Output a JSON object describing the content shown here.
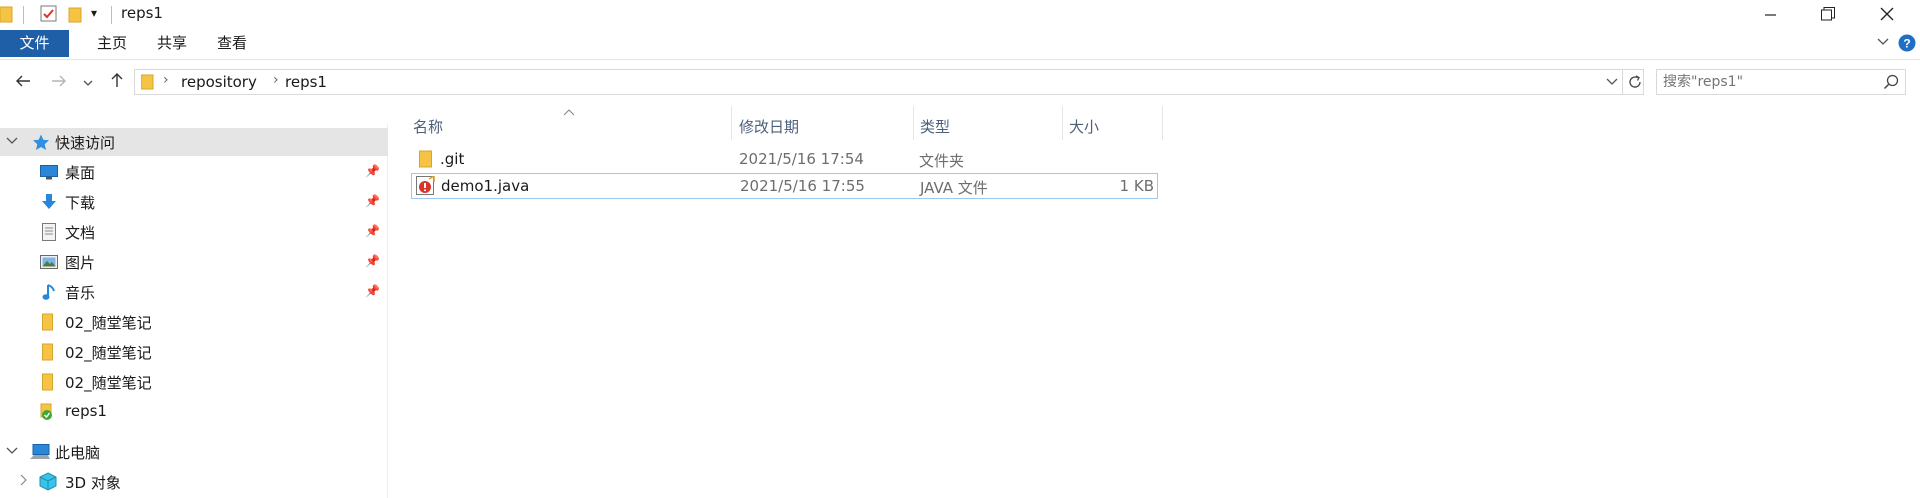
{
  "titlebar": {
    "title": "reps1",
    "quick_access_toolbar": [
      "folder-icon",
      "properties-icon",
      "new-folder-icon",
      "customize-dropdown-icon"
    ],
    "controls": [
      "minimize-icon",
      "maximize-icon",
      "close-icon"
    ]
  },
  "ribbon": {
    "tabs": [
      {
        "label": "文件",
        "active": true
      },
      {
        "label": "主页"
      },
      {
        "label": "共享"
      },
      {
        "label": "查看"
      }
    ],
    "expand_icon": "chevron-down-icon",
    "help_icon": "help-icon"
  },
  "address_bar": {
    "path": [
      "repository",
      "reps1"
    ],
    "back_icon": "arrow-left-icon",
    "forward_icon": "arrow-right-icon",
    "recent_icon": "chevron-down-icon",
    "up_icon": "arrow-up-icon",
    "refresh_icon": "refresh-icon"
  },
  "search": {
    "placeholder": "搜索\"reps1\"",
    "icon": "search-icon"
  },
  "sidebar": {
    "quick_access": {
      "label": "快速访问"
    },
    "items": [
      {
        "label": "桌面",
        "icon": "desktop-icon",
        "pinned": true
      },
      {
        "label": "下载",
        "icon": "download-icon",
        "pinned": true
      },
      {
        "label": "文档",
        "icon": "document-icon",
        "pinned": true
      },
      {
        "label": "图片",
        "icon": "pictures-icon",
        "pinned": true
      },
      {
        "label": "音乐",
        "icon": "music-icon",
        "pinned": true
      },
      {
        "label": "02_随堂笔记",
        "icon": "folder-icon"
      },
      {
        "label": "02_随堂笔记",
        "icon": "folder-icon"
      },
      {
        "label": "02_随堂笔记",
        "icon": "folder-icon"
      },
      {
        "label": "reps1",
        "icon": "git-folder-icon"
      }
    ],
    "this_pc": {
      "label": "此电脑"
    },
    "pc_items": [
      {
        "label": "3D 对象",
        "icon": "3d-objects-icon"
      }
    ]
  },
  "filelist": {
    "columns": [
      "名称",
      "修改日期",
      "类型",
      "大小"
    ],
    "sort_icon": "sort-up-icon",
    "rows": [
      {
        "name": ".git",
        "modified": "2021/5/16 17:54",
        "type": "文件夹",
        "size": "",
        "icon": "folder-icon"
      },
      {
        "name": "demo1.java",
        "modified": "2021/5/16 17:55",
        "type": "JAVA 文件",
        "size": "1 KB",
        "icon": "java-file-icon",
        "selected": true
      }
    ]
  },
  "colors": {
    "accent": "#1f5fa8",
    "selection_border": "#99c9ef",
    "folder": "#f6c344"
  }
}
